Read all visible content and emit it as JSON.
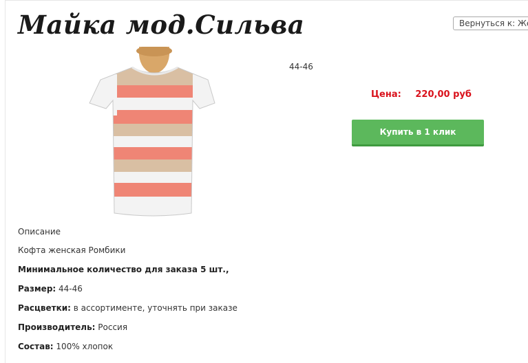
{
  "product": {
    "title": "Майка мод.Сильва",
    "size_top": "44-46",
    "price_label": "Цена:",
    "price_value": "220,00 руб",
    "buy_button": "Купить в 1 клик"
  },
  "nav": {
    "back_select": "Вернуться к: Жен"
  },
  "description": {
    "heading": "Описание",
    "name": "Кофта женская Ромбики",
    "min_order": "Минимальное количество для заказа 5 шт.,",
    "size_label": "Размер:",
    "size_value": " 44-46",
    "colors_label": "Расцветки:",
    "colors_value": " в ассортименте, уточнять при заказе",
    "maker_label": "Производитель:",
    "maker_value": " Россия",
    "composition_label": "Состав:",
    "composition_value": " 100% хлопок"
  },
  "colors": {
    "price": "#d9111b",
    "buy_button": "#5cb85c",
    "stripe_coral": "#ef8575",
    "stripe_beige": "#d9bfa3",
    "stripe_white": "#f3f3f3"
  },
  "image": {
    "icon": "knitted-striped-top-on-mannequin"
  }
}
